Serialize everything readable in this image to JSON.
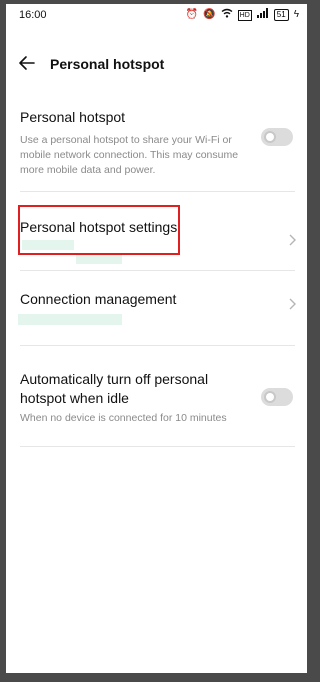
{
  "status_bar": {
    "time": "16:00",
    "battery": "51",
    "icons": [
      "alarm-icon",
      "mute-icon",
      "wifi-icon",
      "hd-icon",
      "signal-icon",
      "charging-icon"
    ]
  },
  "header": {
    "title": "Personal hotspot",
    "back_icon": "back-arrow-icon"
  },
  "items": [
    {
      "title": "Personal hotspot",
      "desc": "Use a personal hotspot to share your Wi-Fi or mobile network connection. This may consume more mobile data and power.",
      "control": "toggle",
      "on": false
    },
    {
      "title": "Personal hotspot settings",
      "control": "chevron"
    },
    {
      "title": "Connection management",
      "control": "chevron"
    },
    {
      "title": "Automatically turn off personal hotspot when idle",
      "desc": "When no device is connected for 10 minutes",
      "control": "toggle",
      "on": false
    }
  ],
  "colors": {
    "highlight": "#e02020",
    "toggle_off": "#dcdcdc"
  }
}
